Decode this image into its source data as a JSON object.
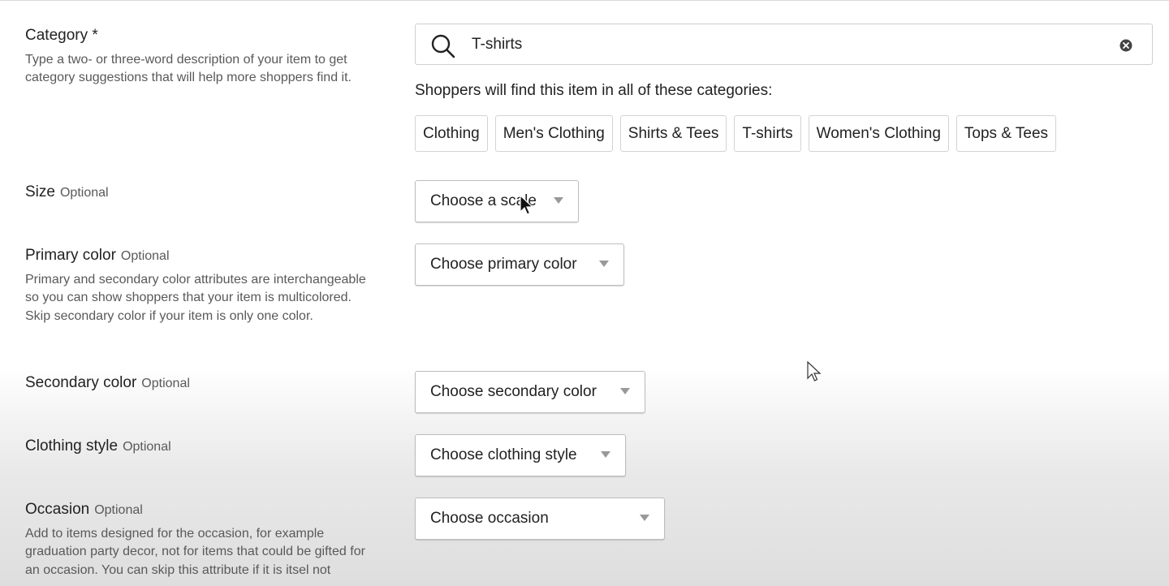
{
  "category": {
    "label": "Category *",
    "description": "Type a two- or three-word description of your item to get category suggestions that will help more shoppers find it.",
    "search_value": "T-shirts",
    "suggestions_heading": "Shoppers will find this item in all of these categories:",
    "chips": [
      "Clothing",
      "Men's Clothing",
      "Shirts & Tees",
      "T-shirts",
      "Women's Clothing",
      "Tops & Tees"
    ]
  },
  "size": {
    "label": "Size",
    "optional": "Optional",
    "select": "Choose a scale"
  },
  "primary_color": {
    "label": "Primary color",
    "optional": "Optional",
    "description": "Primary and secondary color attributes are interchangeable so you can show shoppers that your item is multicolored. Skip secondary color if your item is only one color.",
    "select": "Choose primary color"
  },
  "secondary_color": {
    "label": "Secondary color",
    "optional": "Optional",
    "select": "Choose secondary color"
  },
  "clothing_style": {
    "label": "Clothing style",
    "optional": "Optional",
    "select": "Choose clothing style"
  },
  "occasion": {
    "label": "Occasion",
    "optional": "Optional",
    "description": "Add to items designed for the occasion, for example graduation party decor, not for items that could be gifted for an occasion. You can skip this attribute if it is itsel not",
    "select": "Choose occasion"
  },
  "icons": {
    "search": "search-icon",
    "clear": "clear-icon",
    "caret": "chevron-down-icon",
    "cursor": "mouse-pointer-icon"
  },
  "colors": {
    "text": "#222222",
    "muted": "#595959",
    "border": "#cfcfcf"
  }
}
